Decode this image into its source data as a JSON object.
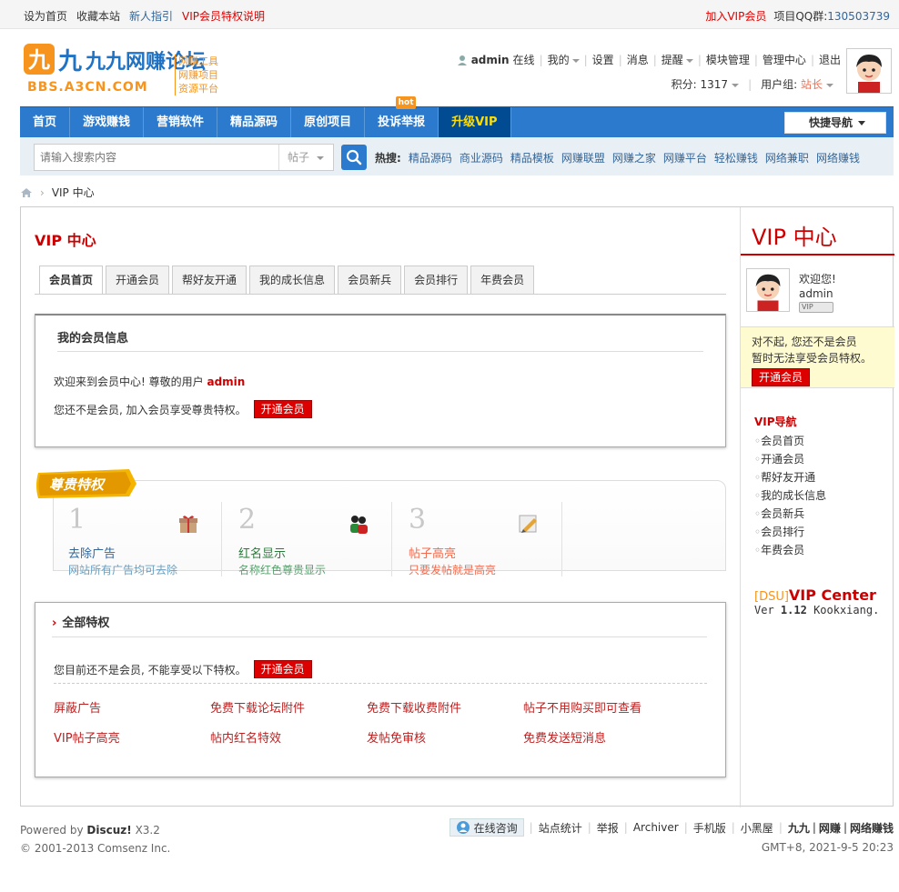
{
  "topbar": {
    "left": [
      "设为首页",
      "收藏本站",
      "新人指引",
      "VIP会员特权说明"
    ],
    "right_vip": "加入VIP会员",
    "qq_label": "项目QQ群:",
    "qq_number": "130503739"
  },
  "logo": {
    "brand": "九九网赚论坛",
    "url": "BBS.A3CN.COM",
    "side": [
      "网赚工具",
      "网赚项目",
      "资源平台"
    ]
  },
  "user": {
    "name": "admin",
    "status": "在线",
    "links": [
      "我的",
      "设置",
      "消息",
      "提醒",
      "模块管理",
      "管理中心",
      "退出"
    ],
    "points_label": "积分: 1317",
    "group_label": "用户组:",
    "group_value": "站长"
  },
  "mainnav": {
    "items": [
      "首页",
      "游戏赚钱",
      "营销软件",
      "精品源码",
      "原创项目",
      "投诉举报",
      "升级VIP"
    ],
    "hot_badge": "hot",
    "quick": "快捷导航"
  },
  "search": {
    "placeholder": "请输入搜索内容",
    "type": "帖子",
    "hot_label": "热搜:",
    "hot_words": [
      "精品源码",
      "商业源码",
      "精品模板",
      "网赚联盟",
      "网赚之家",
      "网赚平台",
      "轻松赚钱",
      "网络兼职",
      "网络赚钱"
    ]
  },
  "breadcrumb": {
    "current": "VIP 中心"
  },
  "main": {
    "title": "VIP 中心",
    "tabs": [
      "会员首页",
      "开通会员",
      "帮好友开通",
      "我的成长信息",
      "会员新兵",
      "会员排行",
      "年费会员"
    ],
    "info": {
      "heading": "我的会员信息",
      "welcome_prefix": "欢迎来到会员中心! 尊敬的用户",
      "welcome_user": "admin",
      "not_member": "您还不是会员, 加入会员享受尊贵特权。",
      "btn": "开通会员"
    },
    "privileges": {
      "ribbon": "尊贵特权",
      "cards": [
        {
          "num": "1",
          "title": "去除广告",
          "desc": "网站所有广告均可去除",
          "color": "#5aa06f",
          "title_color": "#336699",
          "icon": "gift-icon"
        },
        {
          "num": "2",
          "title": "红名显示",
          "desc": "名称红色尊贵显示",
          "color": "#5aa06f",
          "title_color": "#2a8a3a",
          "icon": "users-icon"
        },
        {
          "num": "3",
          "title": "帖子高亮",
          "desc": "只要发帖就是高亮",
          "color": "#f26c4f",
          "title_color": "#f26c4f",
          "icon": "pencil-icon"
        }
      ]
    },
    "all": {
      "heading": "全部特权",
      "line": "您目前还不是会员, 不能享受以下特权。",
      "btn": "开通会员",
      "items": [
        "屏蔽广告",
        "免费下载论坛附件",
        "免费下载收费附件",
        "帖子不用购买即可查看",
        "VIP帖子高亮",
        "帖内红名特效",
        "发帖免审核",
        "免费发送短消息"
      ]
    }
  },
  "side": {
    "title": "VIP 中心",
    "welcome": "欢迎您!",
    "name": "admin",
    "vip_mark": "VIP",
    "notice1": "对不起, 您还不是会员",
    "notice2": "暂时无法享受会员特权。",
    "btn": "开通会员",
    "nav_heading": "VIP导航",
    "nav": [
      "会员首页",
      "开通会员",
      "帮好友开通",
      "我的成长信息",
      "会员新兵",
      "会员排行",
      "年费会员"
    ],
    "dsu_tag": "[DSU]",
    "dsu_name": "VIP Center",
    "ver_prefix": "Ver",
    "ver_num": "1.12",
    "ver_author": "Kookxiang."
  },
  "footer": {
    "powered_prefix": "Powered by",
    "powered_name": "Discuz!",
    "powered_ver": "X3.2",
    "copyright": "© 2001-2013 Comsenz Inc.",
    "consult": "在线咨询",
    "links": [
      "站点统计",
      "举报",
      "Archiver",
      "手机版",
      "小黑屋"
    ],
    "brand_links": [
      "九九",
      "网赚",
      "网络赚钱"
    ],
    "gmt": "GMT+8, 2021-9-5 20:23"
  }
}
